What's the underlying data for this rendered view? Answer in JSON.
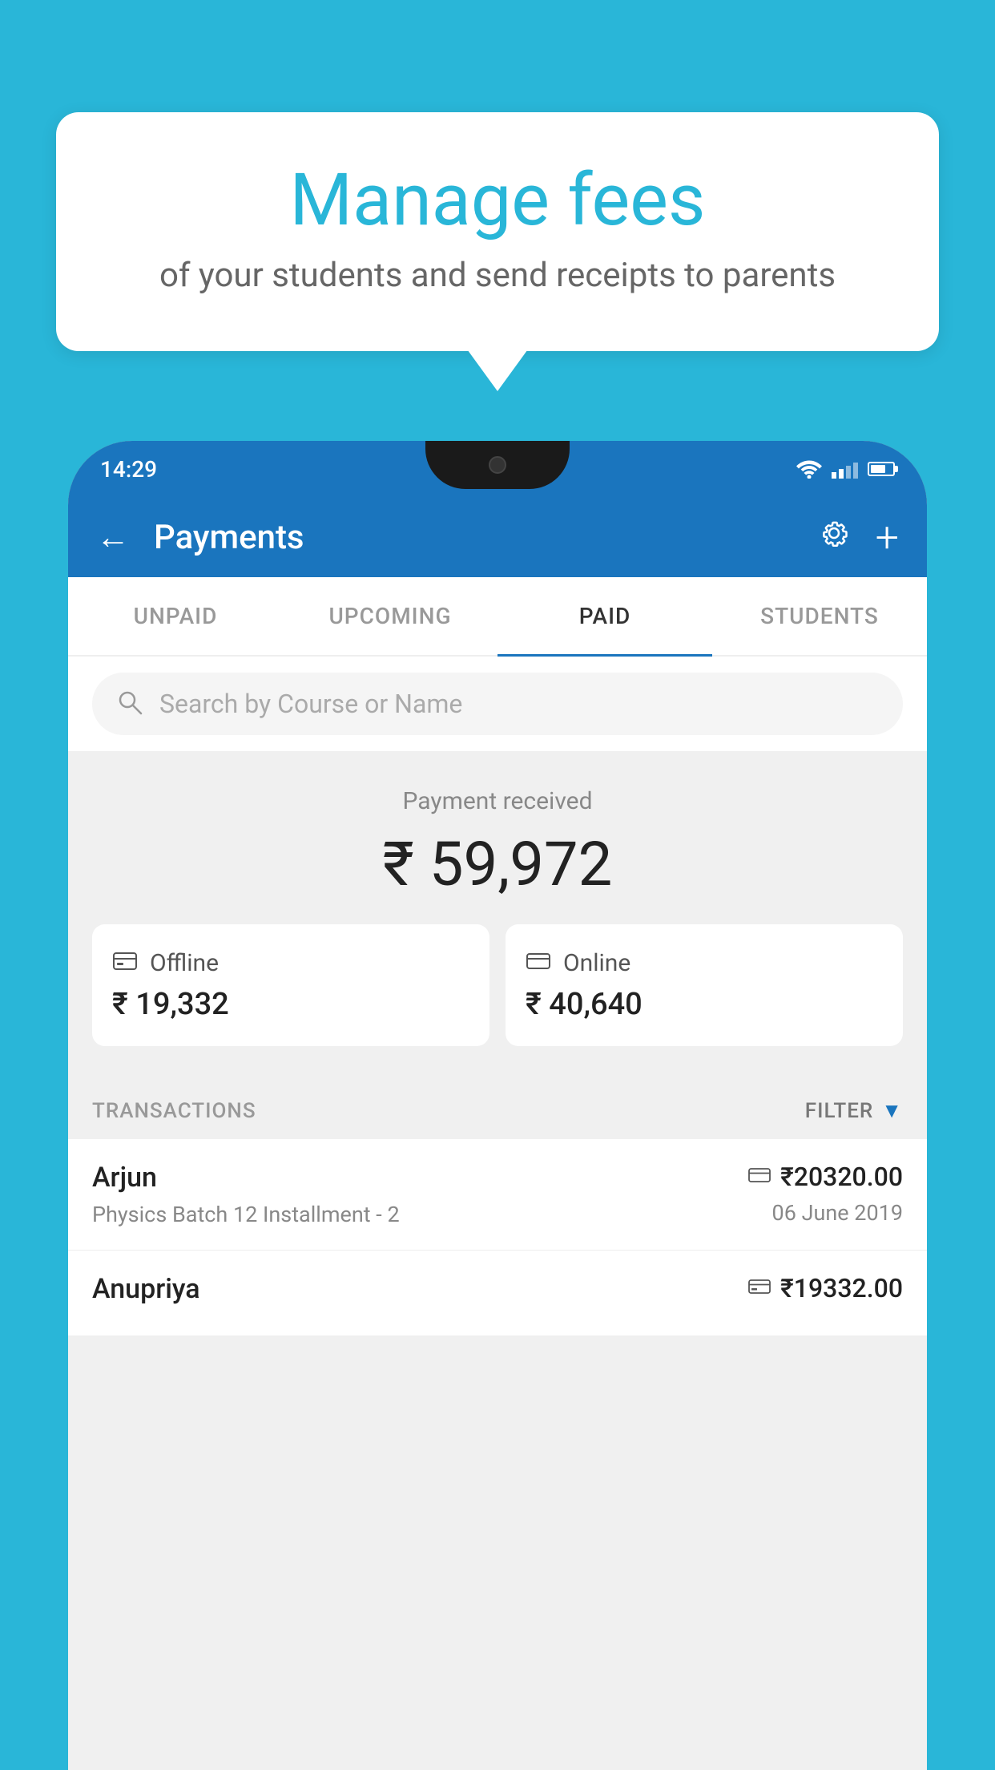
{
  "background_color": "#29b6d8",
  "speech_bubble": {
    "title": "Manage fees",
    "subtitle": "of your students and send receipts to parents"
  },
  "phone": {
    "status_bar": {
      "time": "14:29"
    },
    "header": {
      "title": "Payments",
      "back_label": "←",
      "gear_symbol": "⚙",
      "plus_symbol": "+"
    },
    "tabs": [
      {
        "label": "UNPAID",
        "active": false
      },
      {
        "label": "UPCOMING",
        "active": false
      },
      {
        "label": "PAID",
        "active": true
      },
      {
        "label": "STUDENTS",
        "active": false
      }
    ],
    "search": {
      "placeholder": "Search by Course or Name"
    },
    "payment_summary": {
      "label": "Payment received",
      "total": "₹ 59,972",
      "offline_label": "Offline",
      "offline_amount": "₹ 19,332",
      "online_label": "Online",
      "online_amount": "₹ 40,640"
    },
    "transactions": {
      "section_label": "TRANSACTIONS",
      "filter_label": "FILTER",
      "rows": [
        {
          "name": "Arjun",
          "detail": "Physics Batch 12 Installment - 2",
          "amount": "₹20320.00",
          "date": "06 June 2019",
          "payment_type": "online"
        },
        {
          "name": "Anupriya",
          "detail": "",
          "amount": "₹19332.00",
          "date": "",
          "payment_type": "offline"
        }
      ]
    }
  }
}
